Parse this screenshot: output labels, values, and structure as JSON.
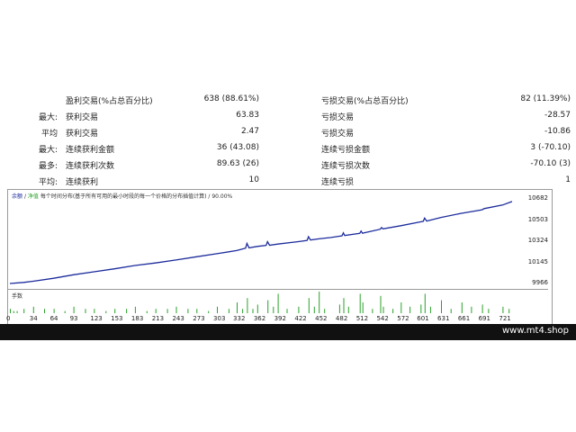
{
  "stats_rows": [
    {
      "label": "",
      "name": "盈利交易(%占总百分比)",
      "value": "638 (88.61%)",
      "name2": "亏损交易(%占总百分比)",
      "value2": "82 (11.39%)"
    },
    {
      "label": "最大:",
      "name": "获利交易",
      "value": "63.83",
      "name2": "亏损交易",
      "value2": "-28.57"
    },
    {
      "label": "平均",
      "name": "获利交易",
      "value": "2.47",
      "name2": "亏损交易",
      "value2": "-10.86"
    },
    {
      "label": "最大:",
      "name": "连续获利金额",
      "value": "36 (43.08)",
      "name2": "连续亏损金额",
      "value2": "3 (-70.10)"
    },
    {
      "label": "最多:",
      "name": "连续获利次数",
      "value": "89.63 (26)",
      "name2": "连续亏损次数",
      "value2": "-70.10 (3)"
    },
    {
      "label": "平均:",
      "name": "连续获利",
      "value": "10",
      "name2": "连续亏损",
      "value2": "1"
    }
  ],
  "legend": {
    "balance": "余额",
    "separator": "/",
    "equity": "净值",
    "text": "每个时间分布(基于所有可用的最小时段的每一个价格的分布插值计算) / 90.00%"
  },
  "volume_label": "手数",
  "footer_text": "www.mt4.shop",
  "colors": {
    "balance_line": "#1c2c9c",
    "volume_bars": "#2aa22a",
    "footer_bg": "#111111"
  },
  "chart_data": {
    "type": "line",
    "x_ticks": [
      "0",
      "34",
      "64",
      "93",
      "123",
      "153",
      "183",
      "213",
      "243",
      "273",
      "303",
      "332",
      "362",
      "392",
      "422",
      "452",
      "482",
      "512",
      "542",
      "572",
      "601",
      "631",
      "661",
      "691",
      "721"
    ],
    "y_ticks": [
      "10682",
      "10503",
      "10324",
      "10145",
      "9966"
    ],
    "ylim": [
      9966,
      10682
    ],
    "xlim": [
      0,
      735
    ],
    "series": [
      {
        "values": [
          [
            0,
            9966
          ],
          [
            20,
            9975
          ],
          [
            34,
            9985
          ],
          [
            64,
            10010
          ],
          [
            93,
            10040
          ],
          [
            123,
            10065
          ],
          [
            153,
            10090
          ],
          [
            183,
            10118
          ],
          [
            213,
            10140
          ],
          [
            243,
            10165
          ],
          [
            273,
            10192
          ],
          [
            303,
            10218
          ],
          [
            332,
            10245
          ],
          [
            345,
            10265
          ],
          [
            347,
            10305
          ],
          [
            350,
            10268
          ],
          [
            362,
            10280
          ],
          [
            375,
            10288
          ],
          [
            377,
            10320
          ],
          [
            380,
            10290
          ],
          [
            392,
            10300
          ],
          [
            422,
            10320
          ],
          [
            435,
            10330
          ],
          [
            437,
            10362
          ],
          [
            440,
            10334
          ],
          [
            452,
            10344
          ],
          [
            470,
            10355
          ],
          [
            482,
            10366
          ],
          [
            486,
            10370
          ],
          [
            488,
            10395
          ],
          [
            490,
            10372
          ],
          [
            512,
            10390
          ],
          [
            514,
            10410
          ],
          [
            516,
            10392
          ],
          [
            542,
            10425
          ],
          [
            544,
            10440
          ],
          [
            546,
            10428
          ],
          [
            572,
            10455
          ],
          [
            601,
            10488
          ],
          [
            605,
            10492
          ],
          [
            607,
            10520
          ],
          [
            610,
            10495
          ],
          [
            631,
            10525
          ],
          [
            661,
            10560
          ],
          [
            691,
            10590
          ],
          [
            694,
            10600
          ],
          [
            721,
            10630
          ],
          [
            735,
            10660
          ]
        ]
      }
    ],
    "volume": [
      [
        0,
        2
      ],
      [
        5,
        1
      ],
      [
        10,
        1
      ],
      [
        20,
        2
      ],
      [
        34,
        3
      ],
      [
        50,
        2
      ],
      [
        64,
        2
      ],
      [
        80,
        1
      ],
      [
        93,
        3
      ],
      [
        110,
        2
      ],
      [
        123,
        2
      ],
      [
        140,
        1
      ],
      [
        153,
        2
      ],
      [
        170,
        2
      ],
      [
        183,
        3
      ],
      [
        200,
        1
      ],
      [
        213,
        2
      ],
      [
        230,
        2
      ],
      [
        243,
        3
      ],
      [
        260,
        2
      ],
      [
        273,
        2
      ],
      [
        290,
        1
      ],
      [
        303,
        3
      ],
      [
        320,
        2
      ],
      [
        332,
        5
      ],
      [
        340,
        2
      ],
      [
        347,
        7
      ],
      [
        355,
        2
      ],
      [
        362,
        4
      ],
      [
        377,
        6
      ],
      [
        385,
        3
      ],
      [
        392,
        9
      ],
      [
        405,
        2
      ],
      [
        422,
        3
      ],
      [
        437,
        7
      ],
      [
        445,
        3
      ],
      [
        452,
        10
      ],
      [
        460,
        2
      ],
      [
        482,
        4
      ],
      [
        488,
        7
      ],
      [
        495,
        3
      ],
      [
        512,
        9
      ],
      [
        516,
        5
      ],
      [
        530,
        2
      ],
      [
        542,
        8
      ],
      [
        546,
        3
      ],
      [
        560,
        2
      ],
      [
        572,
        5
      ],
      [
        585,
        3
      ],
      [
        601,
        4
      ],
      [
        607,
        9
      ],
      [
        615,
        3
      ],
      [
        631,
        6
      ],
      [
        645,
        2
      ],
      [
        661,
        5
      ],
      [
        675,
        3
      ],
      [
        691,
        4
      ],
      [
        700,
        2
      ],
      [
        721,
        3
      ],
      [
        730,
        2
      ]
    ]
  }
}
